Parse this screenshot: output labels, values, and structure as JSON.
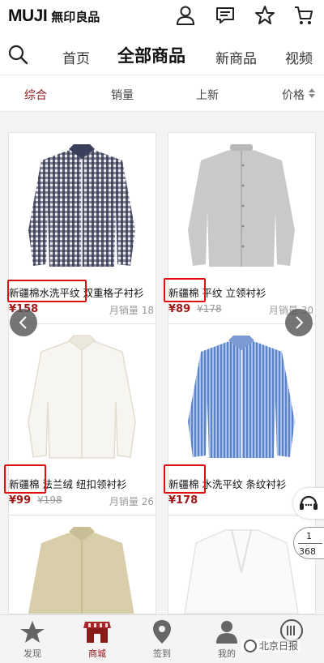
{
  "header": {
    "logo_en": "MUJI",
    "logo_cn": "無印良品",
    "icons": [
      "user-icon",
      "message-icon",
      "star-icon",
      "cart-icon"
    ]
  },
  "nav": {
    "items": [
      "首页",
      "全部商品",
      "新商品",
      "视频"
    ],
    "active_index": 1
  },
  "filter": {
    "items": [
      "综合",
      "销量",
      "上新",
      "价格"
    ],
    "active_index": 0,
    "active_color": "#8b1a1a"
  },
  "products": [
    {
      "name": "新疆棉水洗平纹 双重格子衬衫",
      "price": "¥158",
      "old_price": "",
      "sales": "月销量 18"
    },
    {
      "name": "新疆棉 平纹 立领衬衫",
      "price": "¥89",
      "old_price": "¥178",
      "sales": "月销量 30"
    },
    {
      "name": "新疆棉 法兰绒 纽扣领衬衫",
      "price": "¥99",
      "old_price": "¥198",
      "sales": "月销量 26"
    },
    {
      "name": "新疆棉 水洗平纹 条纹衬衫",
      "price": "¥178",
      "old_price": "",
      "sales": "月销"
    },
    {
      "name": "",
      "price": "",
      "old_price": "",
      "sales": ""
    },
    {
      "name": "",
      "price": "",
      "old_price": "",
      "sales": ""
    }
  ],
  "pager": {
    "current": "1",
    "total": "368"
  },
  "tabbar": {
    "items": [
      "发现",
      "商城",
      "签到",
      "我的",
      "北京日报"
    ],
    "active_index": 1
  },
  "watermark": "北京日报",
  "colors": {
    "accent": "#8b1a1a",
    "price": "#a01818",
    "highlight": "#e11010"
  }
}
